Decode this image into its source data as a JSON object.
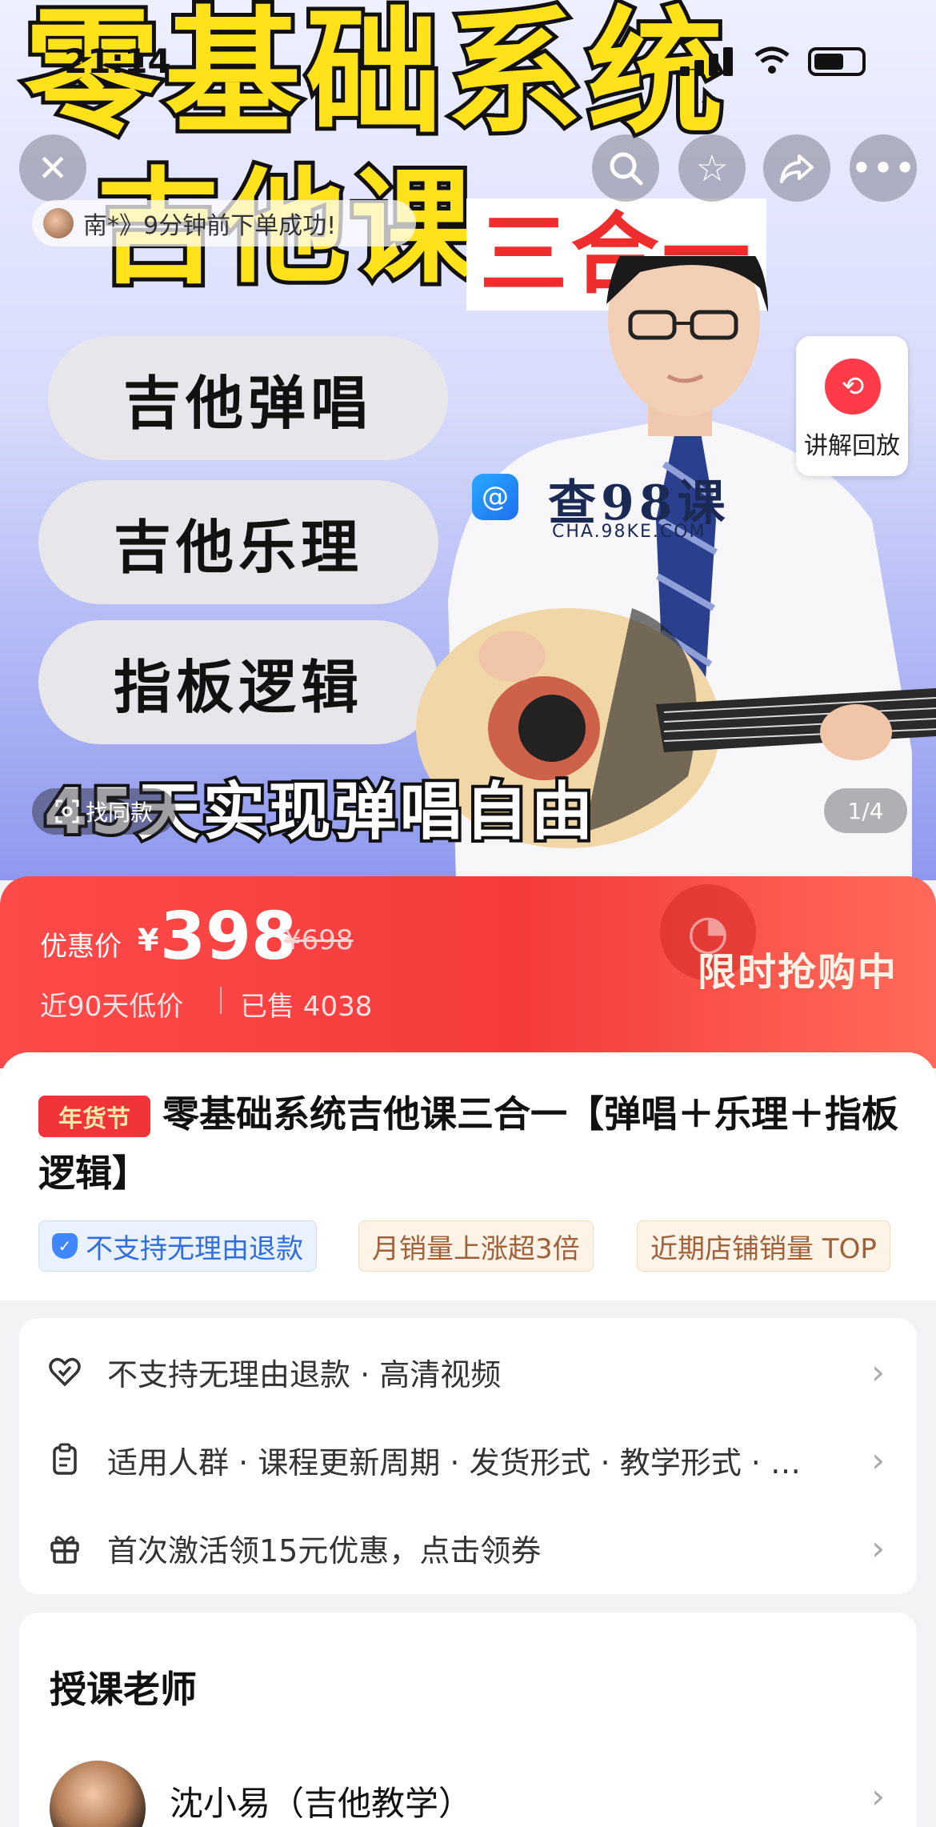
{
  "hero": {
    "title_line1": "零基础系统",
    "title_line2": "吉他课",
    "badge": "三合一",
    "bubbles": [
      "吉他弹唱",
      "吉他乐理",
      "指板逻辑"
    ],
    "slogan": "45天实现弹唱自由",
    "find_same_label": "找同款",
    "page_indicator": "1/4",
    "replay_label": "讲解回放",
    "order_toast": "南*》9分钟前下单成功!",
    "watermark_text": "查98课",
    "watermark_url": "CHA.98KE.COM"
  },
  "status_bar": {
    "time": "21:14"
  },
  "price": {
    "label": "优惠价",
    "currency": "¥",
    "value": "398",
    "original": "¥698",
    "sub_low": "近90天低价",
    "sold": "已售 4038",
    "flash": "限时抢购中"
  },
  "product": {
    "festival_tag": "年货节",
    "title": "零基础系统吉他课三合一【弹唱＋乐理＋指板逻辑】",
    "chips": [
      "不支持无理由退款",
      "月销量上涨超3倍",
      "近期店铺销量 TOP"
    ]
  },
  "info_rows": [
    {
      "icon": "heart-shield-icon",
      "text": "不支持无理由退款 · 高清视频"
    },
    {
      "icon": "clipboard-icon",
      "text": "适用人群 · 课程更新周期 · 发货形式 · 教学形式 · …"
    },
    {
      "icon": "gift-icon",
      "text": "首次激活领15元优惠，点击领券"
    }
  ],
  "teacher": {
    "heading": "授课老师",
    "name": "沈小易（吉他教学）"
  },
  "colors": {
    "price_red": "#f53b3b",
    "title_yellow": "#ffe21a",
    "badge_red": "#f02d2d",
    "chip_blue": "#2f6de0",
    "chip_gold": "#a0613a"
  }
}
